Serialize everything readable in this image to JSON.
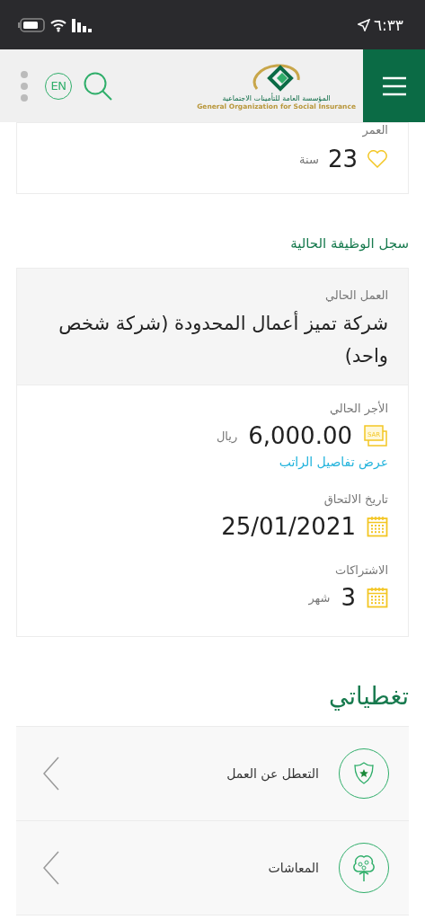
{
  "status_bar": {
    "time": "٦:٣٣"
  },
  "header": {
    "language_button": "EN",
    "logo_arabic": "المؤسسة العامة للتأمينات الاجتماعية",
    "logo_english": "General Organization for Social Insurance"
  },
  "age": {
    "label": "العمر",
    "value": "23",
    "unit": "سنة"
  },
  "job_section": {
    "title": "سجل الوظيفة الحالية",
    "employer_label": "العمل الحالي",
    "employer": "شركة تميز أعمال المحدودة (شركة شخص واحد)",
    "fields": [
      {
        "kind": "wage",
        "label": "الأجر الحالي",
        "badge": "SAR",
        "value": "6,000.00",
        "unit": "ريال",
        "link": "عرض تفاصيل الراتب"
      },
      {
        "kind": "date",
        "label": "تاريخ الالتحاق",
        "value": "25/01/2021"
      },
      {
        "kind": "count",
        "label": "الاشتراكات",
        "value": "3",
        "unit": "شهر"
      }
    ]
  },
  "coverages": {
    "title": "تغطياتي",
    "items": [
      {
        "kind": "shield",
        "label": "التعطل عن العمل"
      },
      {
        "kind": "tree",
        "label": "المعاشات"
      }
    ]
  }
}
